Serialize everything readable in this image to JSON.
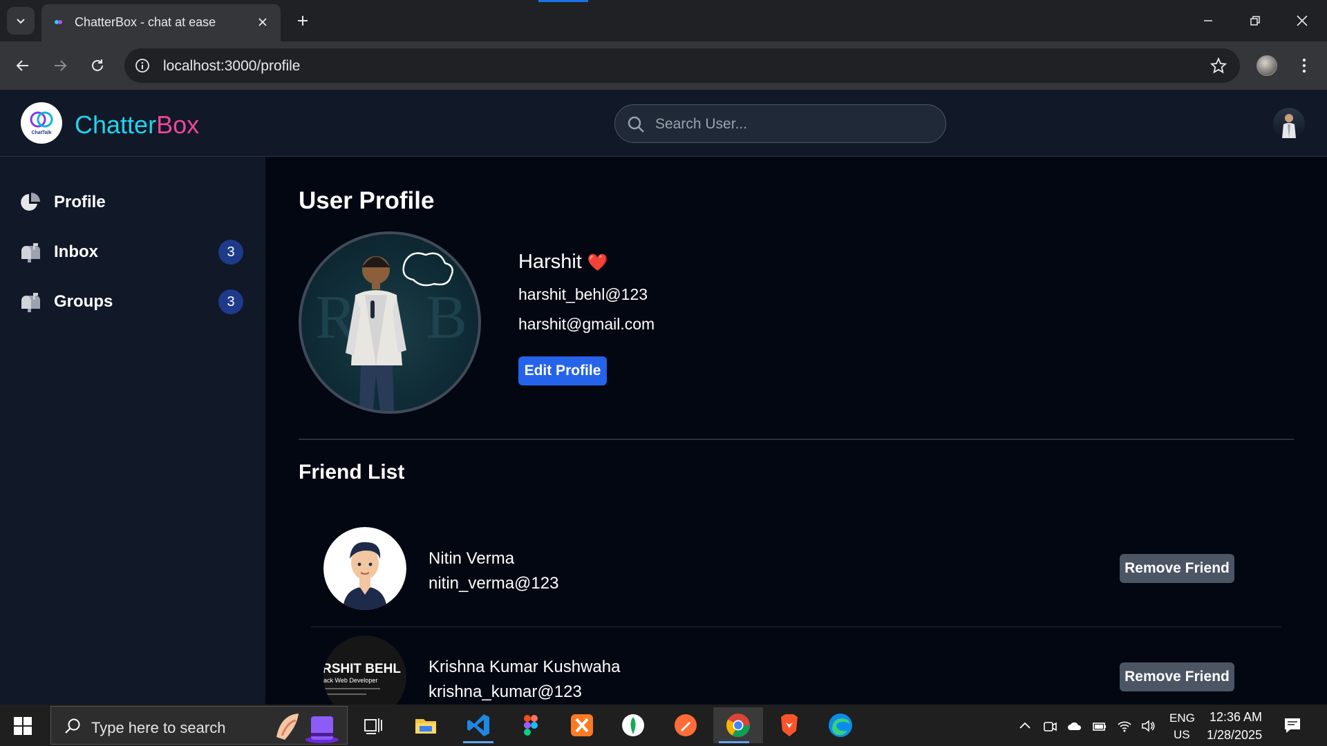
{
  "browser": {
    "tab_title": "ChatterBox - chat at ease",
    "url": "localhost:3000/profile"
  },
  "header": {
    "brand_part1": "Chatter",
    "brand_part2": "Box",
    "logo_text": "ChatTalk",
    "search_placeholder": "Search User..."
  },
  "sidebar": {
    "items": [
      {
        "label": "Profile",
        "icon": "pie-chart-icon"
      },
      {
        "label": "Inbox",
        "icon": "mailbox-icon",
        "badge": "3"
      },
      {
        "label": "Groups",
        "icon": "mailbox-icon",
        "badge": "3"
      }
    ]
  },
  "profile": {
    "page_title": "User Profile",
    "name": "Harshit",
    "heart": "❤️",
    "username": "harshit_behl@123",
    "email": "harshit@gmail.com",
    "edit_label": "Edit Profile"
  },
  "friends": {
    "title": "Friend List",
    "list": [
      {
        "name": "Nitin Verma",
        "username": "nitin_verma@123",
        "action": "Remove Friend"
      },
      {
        "name": "Krishna Kumar Kushwaha",
        "username": "krishna_kumar@123",
        "action": "Remove Friend",
        "avatar_text": "RSHIT BEHL",
        "avatar_subtext": "ack Web Developer"
      }
    ]
  },
  "taskbar": {
    "search_text": "Type here to search",
    "lang_line1": "ENG",
    "lang_line2": "US",
    "time": "12:36 AM",
    "date": "1/28/2025"
  },
  "colors": {
    "accent_blue": "#2563eb",
    "brand_cyan": "#22d3ee",
    "brand_pink": "#ec4899",
    "badge_bg": "#1e3a8a",
    "remove_bg": "#4b5563"
  }
}
